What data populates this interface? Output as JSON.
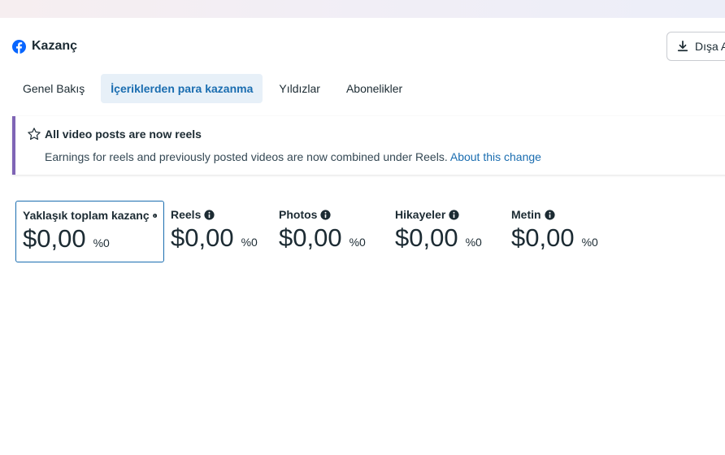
{
  "header": {
    "title": "Kazanç",
    "export_label": "Dışa A"
  },
  "tabs": [
    {
      "label": "Genel Bakış",
      "active": false
    },
    {
      "label": "İçeriklerden para kazanma",
      "active": true
    },
    {
      "label": "Yıldızlar",
      "active": false
    },
    {
      "label": "Abonelikler",
      "active": false
    }
  ],
  "notice": {
    "title": "All video posts are now reels",
    "body": "Earnings for reels and previously posted videos are now combined under Reels.",
    "link": "About this change"
  },
  "metrics": [
    {
      "label": "Yaklaşık toplam kazanç",
      "value": "$0,00",
      "percent": "%0"
    },
    {
      "label": "Reels",
      "value": "$0,00",
      "percent": "%0"
    },
    {
      "label": "Photos",
      "value": "$0,00",
      "percent": "%0"
    },
    {
      "label": "Hikayeler",
      "value": "$0,00",
      "percent": "%0"
    },
    {
      "label": "Metin",
      "value": "$0,00",
      "percent": "%0"
    }
  ],
  "colors": {
    "accent": "#1a6db0",
    "notice_border": "#7f64b5",
    "facebook_blue": "#0866ff"
  }
}
